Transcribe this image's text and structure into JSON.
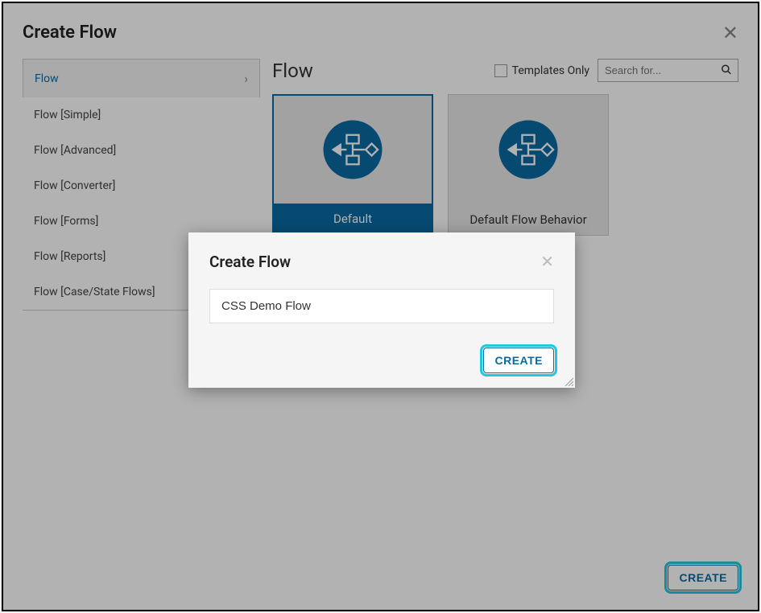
{
  "main": {
    "title": "Create Flow",
    "content_title": "Flow",
    "templates_only_label": "Templates Only",
    "search_placeholder": "Search for...",
    "create_button": "CREATE"
  },
  "sidebar": {
    "items": [
      {
        "label": "Flow",
        "active": true
      },
      {
        "label": "Flow [Simple]"
      },
      {
        "label": "Flow [Advanced]"
      },
      {
        "label": "Flow [Converter]"
      },
      {
        "label": "Flow [Forms]"
      },
      {
        "label": "Flow [Reports]"
      },
      {
        "label": "Flow [Case/State Flows]"
      }
    ]
  },
  "cards": [
    {
      "label": "Default",
      "selected": true
    },
    {
      "label": "Default Flow Behavior",
      "selected": false
    }
  ],
  "inner_modal": {
    "title": "Create Flow",
    "input_value": "CSS Demo Flow",
    "create_button": "CREATE"
  }
}
